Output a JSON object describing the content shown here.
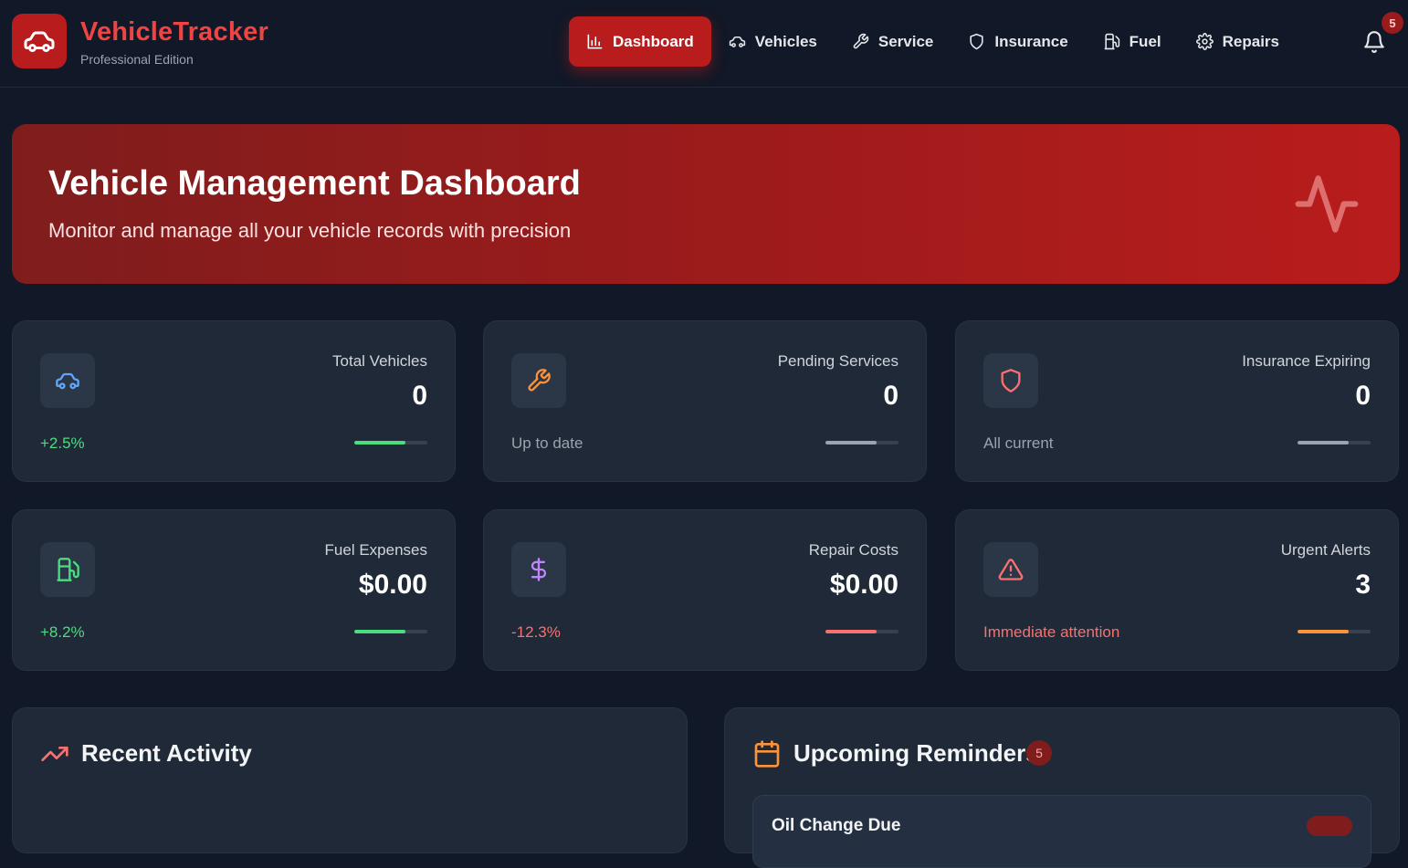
{
  "app": {
    "title": "VehicleTracker",
    "subtitle": "Professional Edition",
    "logo_icon": "car-icon",
    "notification_count": "5"
  },
  "nav": {
    "items": [
      {
        "label": "Dashboard",
        "icon": "bar-chart-icon",
        "active": true
      },
      {
        "label": "Vehicles",
        "icon": "car-icon"
      },
      {
        "label": "Service",
        "icon": "wrench-icon"
      },
      {
        "label": "Insurance",
        "icon": "shield-icon"
      },
      {
        "label": "Fuel",
        "icon": "fuel-icon"
      },
      {
        "label": "Repairs",
        "icon": "gear-icon"
      }
    ]
  },
  "hero": {
    "title": "Vehicle Management Dashboard",
    "subtitle": "Monitor and manage all your vehicle records with precision",
    "icon": "activity-icon"
  },
  "stats": [
    {
      "label": "Total Vehicles",
      "value": "0",
      "trend": "+2.5%",
      "trend_color": "#4ade80",
      "icon": "car-icon",
      "icon_color": "#60a5fa",
      "bar_color": "#4ade80",
      "bar_level": 0.7
    },
    {
      "label": "Pending Services",
      "value": "0",
      "trend": "Up to date",
      "trend_color": "#9ca3af",
      "icon": "wrench-icon",
      "icon_color": "#fb923c",
      "bar_color": "#9ca3af",
      "bar_level": 0.7
    },
    {
      "label": "Insurance Expiring",
      "value": "0",
      "trend": "All current",
      "trend_color": "#9ca3af",
      "icon": "shield-icon",
      "icon_color": "#f87171",
      "bar_color": "#9ca3af",
      "bar_level": 0.7
    },
    {
      "label": "Fuel Expenses",
      "value": "$0.00",
      "trend": "+8.2%",
      "trend_color": "#4ade80",
      "icon": "fuel-icon",
      "icon_color": "#4ade80",
      "bar_color": "#4ade80",
      "bar_level": 0.7
    },
    {
      "label": "Repair Costs",
      "value": "$0.00",
      "trend": "-12.3%",
      "trend_color": "#f87171",
      "icon": "dollar-icon",
      "icon_color": "#c084fc",
      "bar_color": "#f87171",
      "bar_level": 0.7
    },
    {
      "label": "Urgent Alerts",
      "value": "3",
      "trend": "Immediate attention",
      "trend_color": "#f87171",
      "icon": "alert-triangle-icon",
      "icon_color": "#f87171",
      "bar_color": "#fb923c",
      "bar_level": 0.7
    }
  ],
  "recent_activity": {
    "title": "Recent Activity",
    "icon": "trending-up-icon"
  },
  "reminders": {
    "title": "Upcoming Reminders",
    "count": "5",
    "icon": "calendar-icon",
    "items": [
      {
        "title": "Oil Change Due"
      }
    ]
  }
}
